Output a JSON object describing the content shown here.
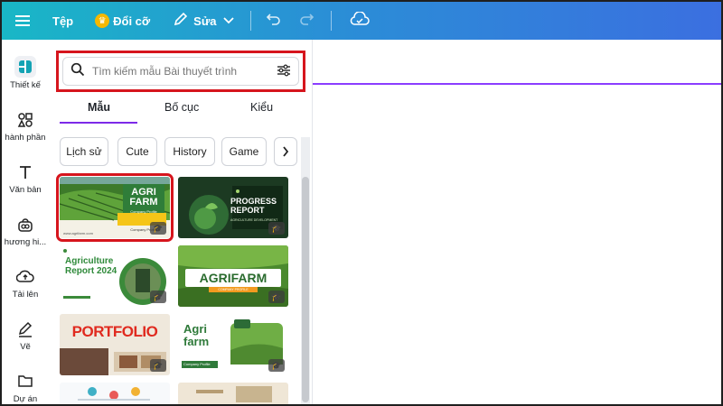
{
  "topbar": {
    "file_label": "Tệp",
    "change_size_label": "Đổi cỡ",
    "edit_label": "Sửa",
    "icons": [
      "menu-icon",
      "crown-icon",
      "pen-icon",
      "chevron-down-icon",
      "undo-icon",
      "redo-icon",
      "cloud-icon"
    ]
  },
  "rail": {
    "items": [
      {
        "label": "Thiết kế",
        "icon": "design-icon"
      },
      {
        "label": "hành phần",
        "icon": "elements-icon"
      },
      {
        "label": "Văn bản",
        "icon": "text-icon"
      },
      {
        "label": "hương hi...",
        "icon": "brand-icon"
      },
      {
        "label": "Tải lên",
        "icon": "upload-icon"
      },
      {
        "label": "Vẽ",
        "icon": "draw-icon"
      },
      {
        "label": "Dự án",
        "icon": "folder-icon"
      }
    ]
  },
  "panel": {
    "search_placeholder": "Tìm kiếm mẫu Bài thuyết trình",
    "tabs": [
      "Mẫu",
      "Bố cục",
      "Kiểu"
    ],
    "chips": [
      "Lịch sử",
      "Cute",
      "History",
      "Game"
    ],
    "templates": [
      {
        "title": "AGRI FARM",
        "subtitle": "Company Profile",
        "theme": "green-yellow"
      },
      {
        "title": "PROGRESS REPORT",
        "subtitle": "AGRICULTURE DEVELOPMENT",
        "theme": "dark-green"
      },
      {
        "title": "Agriculture Report 2024",
        "subtitle": "",
        "theme": "white-green"
      },
      {
        "title": "AGRIFARM",
        "subtitle": "COMPANY PROFILE",
        "theme": "field-green"
      },
      {
        "title": "PORTFOLIO",
        "subtitle": "",
        "theme": "red-cream"
      },
      {
        "title": "Agri farm",
        "subtitle": "Company Profile",
        "theme": "white-field"
      },
      {
        "title": "",
        "subtitle": "",
        "theme": "infographic"
      },
      {
        "title": "",
        "subtitle": "",
        "theme": "beige"
      }
    ]
  },
  "colors": {
    "accent": "#8b3dff",
    "highlight_box": "#d6151d",
    "topbar_start": "#19b7c6",
    "topbar_end": "#3b6fe0"
  }
}
